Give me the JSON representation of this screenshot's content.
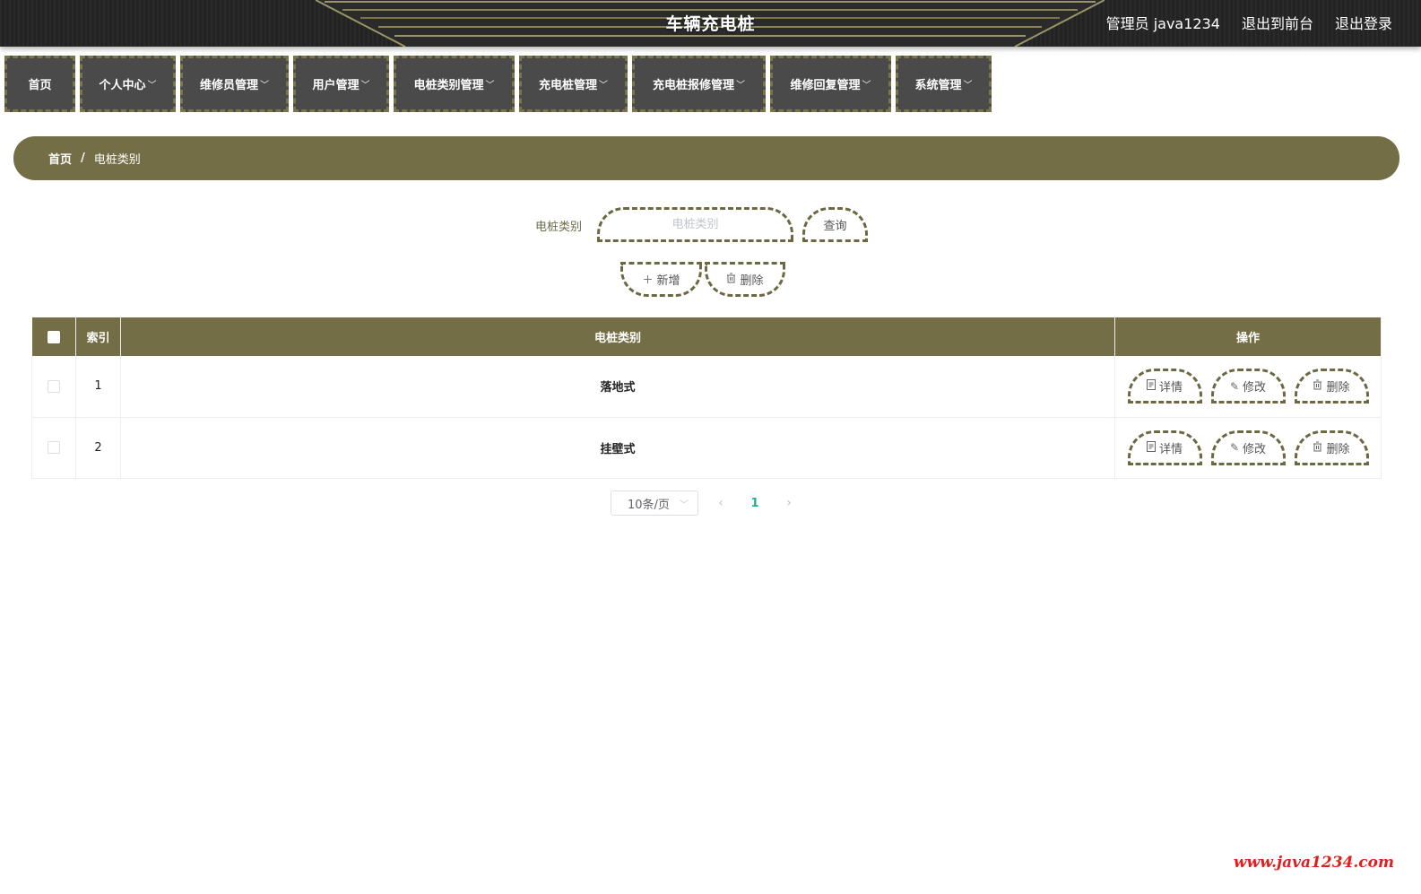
{
  "header": {
    "title": "车辆充电桩",
    "admin_label": "管理员 java1234",
    "front_label": "退出到前台",
    "logout_label": "退出登录"
  },
  "nav": {
    "items": [
      {
        "label": "首页",
        "has_dropdown": false
      },
      {
        "label": "个人中心",
        "has_dropdown": true
      },
      {
        "label": "维修员管理",
        "has_dropdown": true
      },
      {
        "label": "用户管理",
        "has_dropdown": true
      },
      {
        "label": "电桩类别管理",
        "has_dropdown": true
      },
      {
        "label": "充电桩管理",
        "has_dropdown": true
      },
      {
        "label": "充电桩报修管理",
        "has_dropdown": true
      },
      {
        "label": "维修回复管理",
        "has_dropdown": true
      },
      {
        "label": "系统管理",
        "has_dropdown": true
      }
    ]
  },
  "breadcrumb": {
    "home": "首页",
    "separator": "/",
    "current": "电桩类别"
  },
  "search": {
    "label": "电桩类别",
    "placeholder": "电桩类别",
    "value": "",
    "query_label": "查询"
  },
  "actions": {
    "add_label": "新增",
    "delete_label": "删除"
  },
  "table": {
    "columns": [
      "索引",
      "电桩类别",
      "操作"
    ],
    "rows": [
      {
        "index": "1",
        "category": "落地式"
      },
      {
        "index": "2",
        "category": "挂壁式"
      }
    ],
    "row_actions": {
      "detail": "详情",
      "edit": "修改",
      "delete": "删除"
    }
  },
  "pagination": {
    "page_size": "10条/页",
    "current_page": "1"
  },
  "watermark": "www.java1234.com",
  "colors": {
    "accent": "#736e45",
    "nav_bg": "#4a4a4a",
    "active_page": "#1bb28c",
    "watermark": "#e01e1e"
  }
}
